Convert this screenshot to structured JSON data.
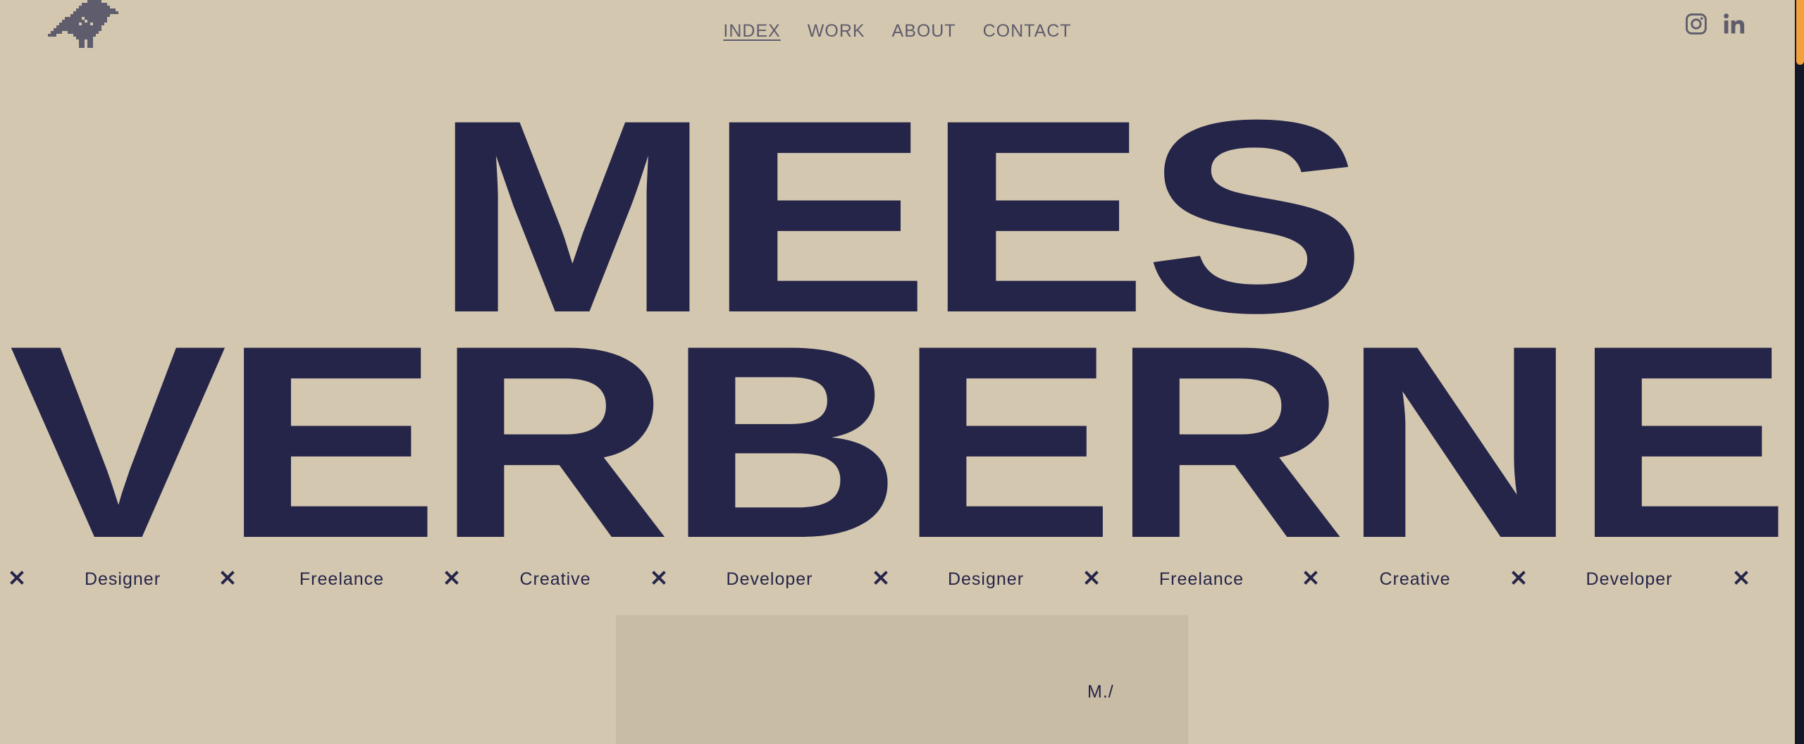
{
  "nav": {
    "items": [
      {
        "label": "INDEX",
        "active": true
      },
      {
        "label": "WORK",
        "active": false
      },
      {
        "label": "ABOUT",
        "active": false
      },
      {
        "label": "CONTACT",
        "active": false
      }
    ]
  },
  "social": {
    "instagram_icon": "instagram-icon",
    "linkedin_icon": "linkedin-icon"
  },
  "hero": {
    "line1": "MEES",
    "line2": "VERBERNE"
  },
  "ticker": {
    "separator_icon": "x-icon",
    "tags": [
      "Designer",
      "Freelance",
      "Creative",
      "Developer",
      "Designer",
      "Freelance",
      "Creative",
      "Developer"
    ]
  },
  "panel": {
    "mark": "M./"
  },
  "colors": {
    "background": "#d4c7af",
    "ink": "#242549",
    "nav_text": "#5e5c6d",
    "accent": "#f2a13b",
    "panel": "#c8bca5"
  }
}
